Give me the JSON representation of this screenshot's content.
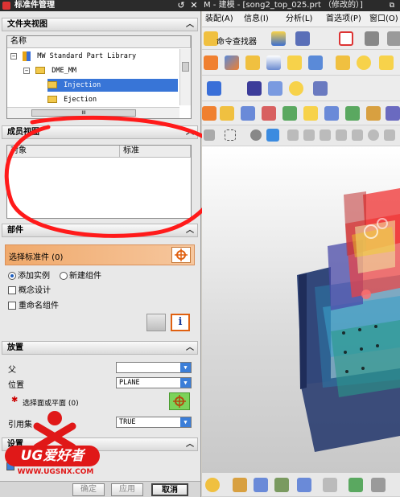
{
  "window": {
    "panel_title": "标准件管理",
    "app_title": "M - 建模 - [song2_top_025.prt （修改的）]"
  },
  "folder_view": {
    "header": "文件夹视图",
    "col_name": "名称",
    "items": [
      {
        "label": "MW Standard Part Library"
      },
      {
        "label": "DME_MM"
      },
      {
        "label": "Injection"
      },
      {
        "label": "Ejection"
      }
    ],
    "hscroll": "III"
  },
  "member_view": {
    "header": "成员视图",
    "col_object": "对象",
    "col_standard": "标准"
  },
  "part": {
    "header": "部件",
    "select_label": "选择标准件 (0)",
    "add_instance": "添加实例",
    "new_component": "新建组件",
    "concept_design": "概念设计",
    "rename_component": "重命名组件"
  },
  "placement": {
    "header": "放置",
    "parent_label": "父",
    "parent_value": "",
    "position_label": "位置",
    "position_value": "PLANE",
    "select_face_label": "选择面或平面 (0)",
    "ref_set_label": "引用集",
    "ref_set_value": "TRUE"
  },
  "settings": {
    "header": "设置"
  },
  "watermark": {
    "brand": "UG爱好者",
    "url": "WWW.UGSNX.COM"
  },
  "footer": {
    "ok": "确定",
    "apply": "应用",
    "cancel": "取消"
  },
  "menu": {
    "items": [
      "装配(A)",
      "信息(I)",
      "分析(L)",
      "首选项(P)",
      "窗口(O)"
    ]
  },
  "toolbar": {
    "command_finder": "命令查找器"
  },
  "colors": {
    "selection": "#3875d7",
    "highlight_bar": "#f0a96b",
    "dropdown": "#3b7ed8",
    "annotation_circle": "#ff1a1a"
  }
}
